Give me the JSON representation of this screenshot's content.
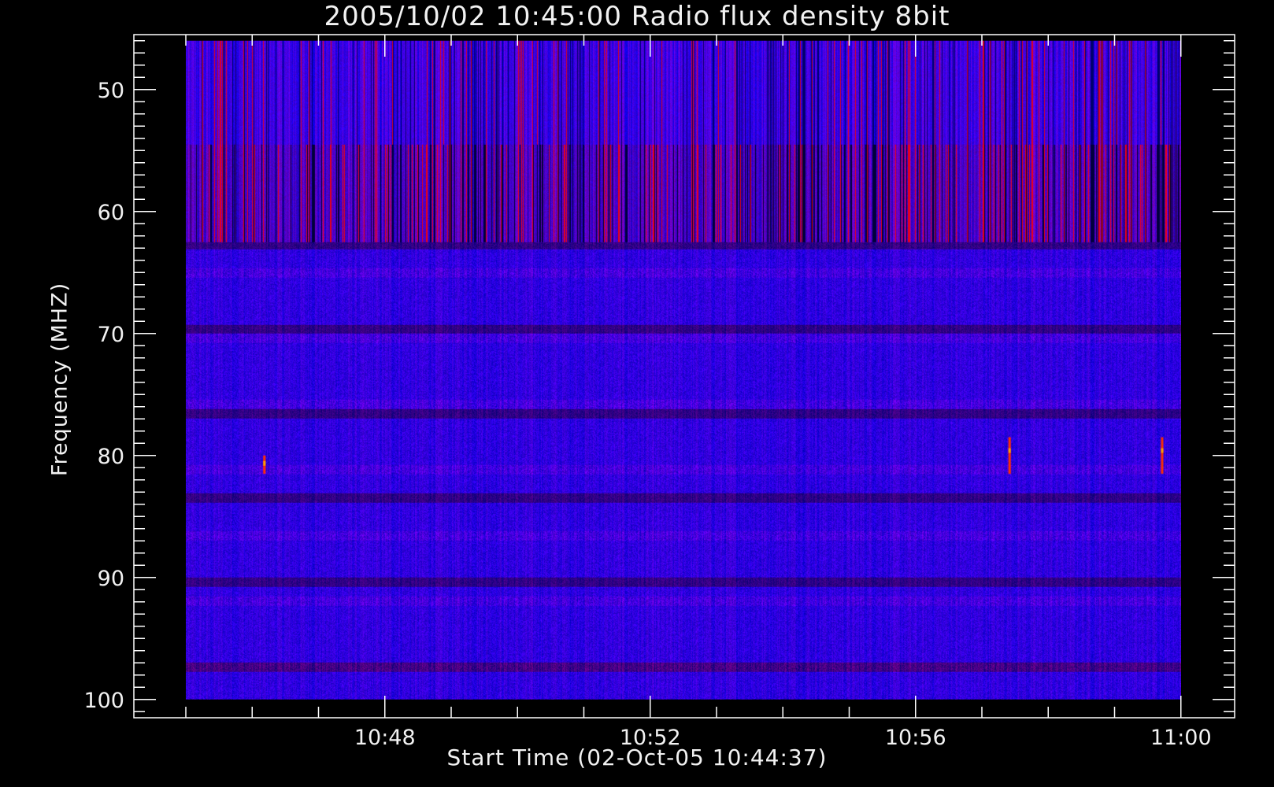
{
  "chart_data": {
    "type": "heatmap",
    "title": "2005/10/02 10:45:00 Radio flux density 8bit",
    "xlabel": "Start Time (02-Oct-05 10:44:37)",
    "ylabel": "Frequency (MHZ)",
    "x_tick_labels": [
      "10:48",
      "10:52",
      "10:56",
      "11:00"
    ],
    "y_tick_labels": [
      "50",
      "60",
      "70",
      "80",
      "90",
      "100"
    ],
    "y_ticks": [
      50,
      60,
      70,
      80,
      90,
      100
    ],
    "y_range": [
      45.5,
      101.5
    ],
    "y_inverted": true,
    "x_range": [
      "10:44:37",
      "11:00:00"
    ],
    "data_x_range": [
      "10:45:00",
      "11:00:00"
    ],
    "data_y_range": [
      46,
      100
    ],
    "colormap": [
      "#000000",
      "#0000ff",
      "#800040",
      "#ff0000",
      "#ff8000"
    ],
    "bursts": [
      {
        "time": "10:46:10",
        "freq_range": [
          80,
          81.5
        ]
      },
      {
        "time": "10:57:24",
        "freq_range": [
          78.5,
          81.5
        ]
      },
      {
        "time": "10:59:42",
        "freq_range": [
          78.5,
          81.5
        ]
      }
    ]
  },
  "colors": {
    "background": "#000000",
    "axis": "#ffffff",
    "spectrum_low": "#0000ff",
    "spectrum_high": "#ff0000"
  }
}
